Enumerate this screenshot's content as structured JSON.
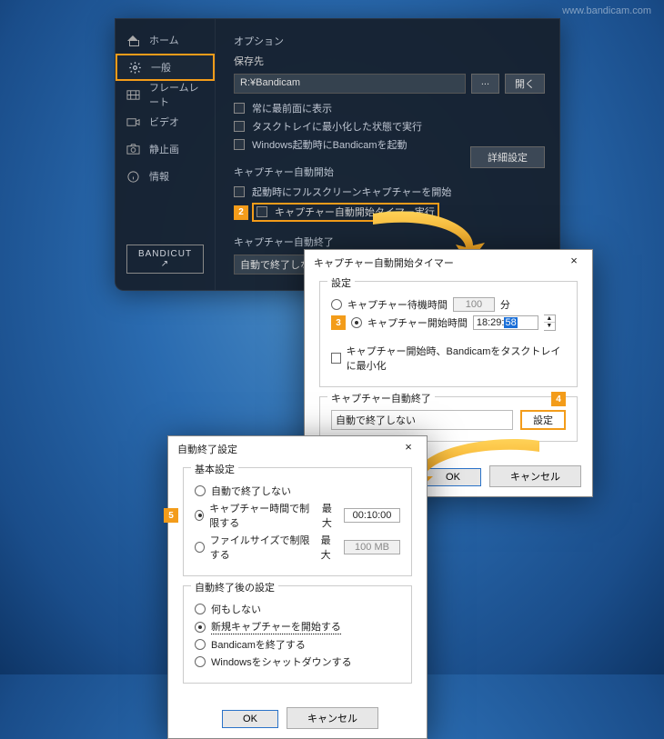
{
  "watermark": "www.bandicam.com",
  "sidebar": {
    "items": [
      {
        "label": "ホーム"
      },
      {
        "label": "一般"
      },
      {
        "label": "フレームレート"
      },
      {
        "label": "ビデオ"
      },
      {
        "label": "静止画"
      },
      {
        "label": "情報"
      }
    ],
    "bandicut": "BANDICUT ↗"
  },
  "main": {
    "option": "オプション",
    "savegroup": "保存先",
    "savepath": "R:¥Bandicam",
    "dots": "...",
    "open": "開く",
    "chk_front": "常に最前面に表示",
    "chk_min": "タスクトレイに最小化した状態で実行",
    "chk_boot": "Windows起動時にBandicamを起動",
    "adv": "詳細設定",
    "autostart": "キャプチャー自動開始",
    "chk_fullscreen": "起動時にフルスクリーンキャプチャーを開始",
    "chk_timer": "キャプチャー自動開始タイマー実行",
    "autoend": "キャプチャー自動終了",
    "autoend_state": "自動で終了しない"
  },
  "timer": {
    "title": "キャプチャー自動開始タイマー",
    "settings_legend": "設定",
    "wait_label": "キャプチャー待機時間",
    "wait_value": "100",
    "wait_unit": "分",
    "start_label": "キャプチャー開始時間",
    "start_time_a": "18:29:",
    "start_time_b": "58",
    "min_tray": "キャプチャー開始時、Bandicamをタスクトレイに最小化",
    "autoend_legend": "キャプチャー自動終了",
    "autoend_state": "自動で終了しない",
    "settings_btn": "設定",
    "ok": "OK",
    "cancel": "キャンセル"
  },
  "autoend": {
    "title": "自動終了設定",
    "basic": "基本設定",
    "r1": "自動で終了しない",
    "r2": "キャプチャー時間で制限する",
    "r2_max": "最大",
    "r2_val": "00:10:00",
    "r3": "ファイルサイズで制限する",
    "r3_max": "最大",
    "r3_val": "100 MB",
    "after": "自動終了後の設定",
    "a1": "何もしない",
    "a2": "新規キャプチャーを開始する",
    "a3": "Bandicamを終了する",
    "a4": "Windowsをシャットダウンする",
    "ok": "OK",
    "cancel": "キャンセル"
  },
  "badges": {
    "n2": "2",
    "n3": "3",
    "n4": "4",
    "n5": "5"
  }
}
